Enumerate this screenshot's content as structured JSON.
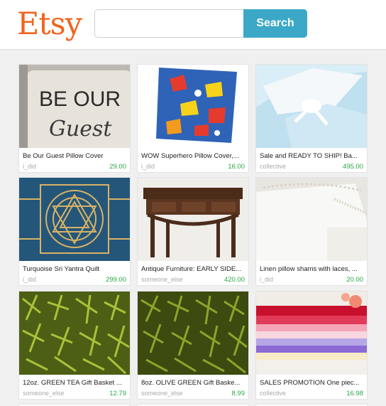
{
  "header": {
    "logo": "Etsy",
    "search_placeholder": "",
    "search_label": "Search"
  },
  "listings": [
    {
      "title": "Be Our Guest Pillow Cover",
      "shop": "i_did",
      "price": "29.00",
      "image_text_1": "BE OUR",
      "image_text_2": "Guest"
    },
    {
      "title": "WOW Superhero Pillow Cover,...",
      "shop": "i_did",
      "price": "16.00"
    },
    {
      "title": "Sale and READY TO SHIP! Ba...",
      "shop": "collective",
      "price": "495.00"
    },
    {
      "title": "Turquoise Sri Yantra Quilt",
      "shop": "i_did",
      "price": "299.00"
    },
    {
      "title": "Antique Furniture: EARLY SIDE...",
      "shop": "someone_else",
      "price": "420.00"
    },
    {
      "title": "Linen pillow shams with laces, ...",
      "shop": "i_did",
      "price": "20.00"
    },
    {
      "title": "12oz. GREEN TEA Gift Basket ...",
      "shop": "someone_else",
      "price": "12.79"
    },
    {
      "title": "8oz. OLIVE GREEN Gift Baske...",
      "shop": "someone_else",
      "price": "8.99"
    },
    {
      "title": "SALES PROMOTION One piec...",
      "shop": "collective",
      "price": "16.98"
    }
  ],
  "colors": {
    "brand": "#f1641e",
    "search_button": "#3ba8c8",
    "price": "#27a844",
    "shop": "#aaaaaa"
  }
}
